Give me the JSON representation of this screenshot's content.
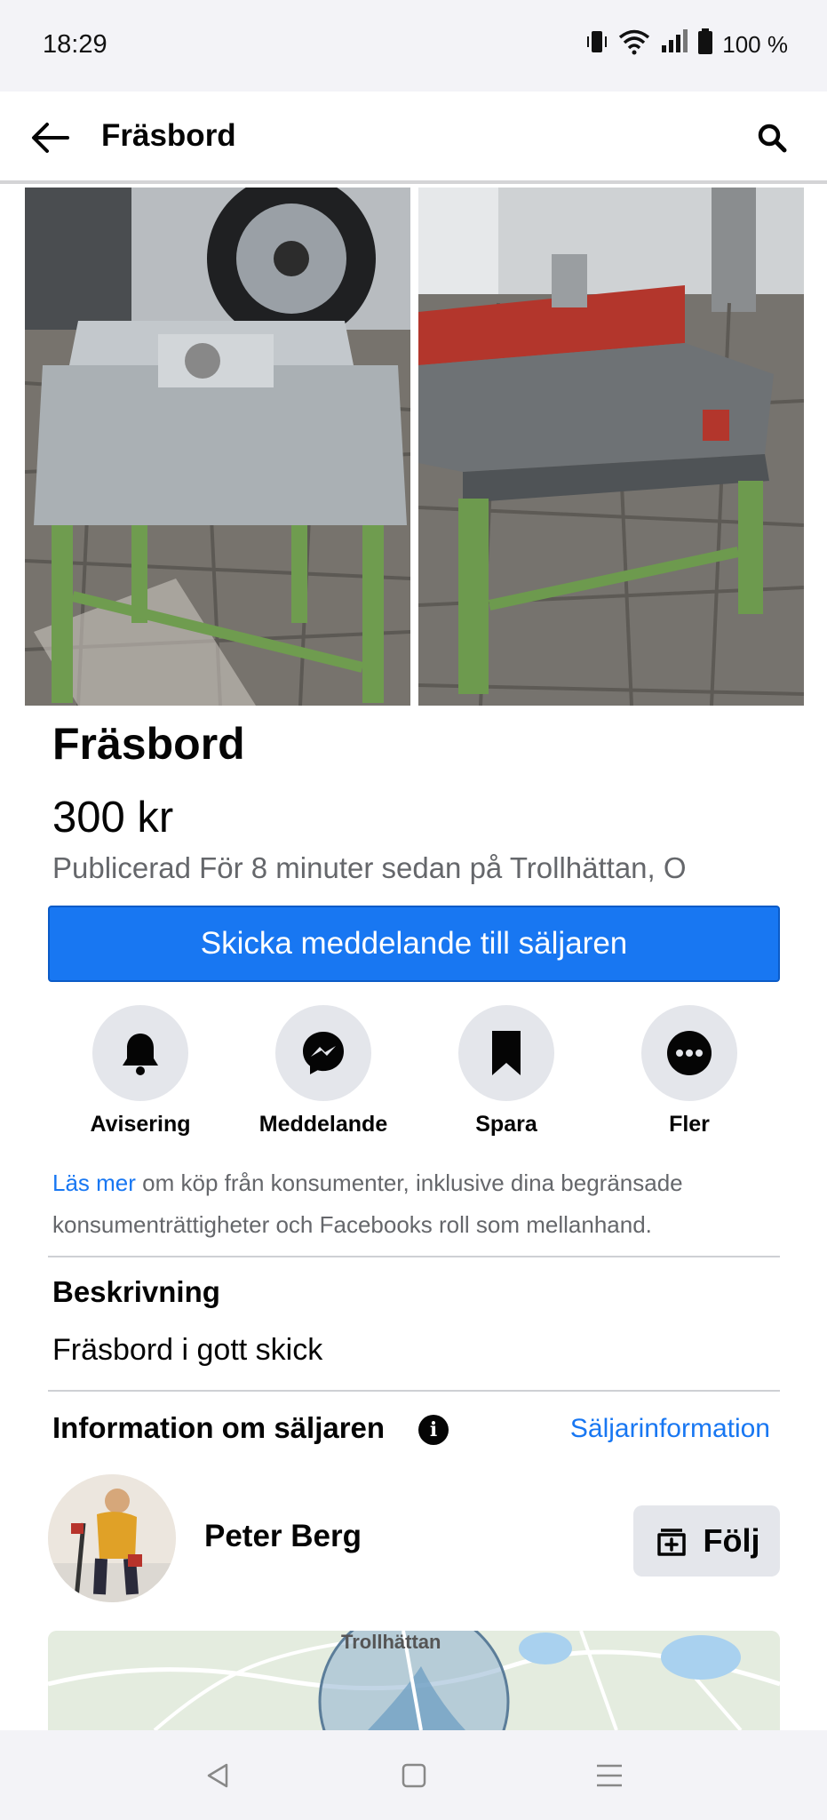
{
  "status_bar": {
    "time": "18:29",
    "battery": "100 %"
  },
  "app_bar": {
    "title": "Fräsbord"
  },
  "listing": {
    "title": "Fräsbord",
    "price": "300 kr",
    "published": "Publicerad För 8 minuter sedan på Trollhättan, O",
    "cta_label": "Skicka meddelande till säljaren"
  },
  "actions": [
    {
      "label": "Avisering",
      "icon": "bell-icon"
    },
    {
      "label": "Meddelande",
      "icon": "messenger-icon"
    },
    {
      "label": "Spara",
      "icon": "bookmark-icon"
    },
    {
      "label": "Fler",
      "icon": "more-icon"
    }
  ],
  "notice": {
    "link": "Läs mer",
    "text": " om köp från konsumenter, inklusive dina begränsade konsumenträttigheter och Facebooks roll som mellanhand."
  },
  "description": {
    "heading": "Beskrivning",
    "text": "Fräsbord i gott skick"
  },
  "seller": {
    "heading": "Information om säljaren",
    "info_link": "Säljarinformation",
    "name": "Peter Berg",
    "follow_label": "Följ"
  },
  "map": {
    "label": "Trollhättan"
  },
  "colors": {
    "accent": "#1877f2",
    "secondary_text": "#65676b",
    "button_grey": "#e4e6eb"
  }
}
